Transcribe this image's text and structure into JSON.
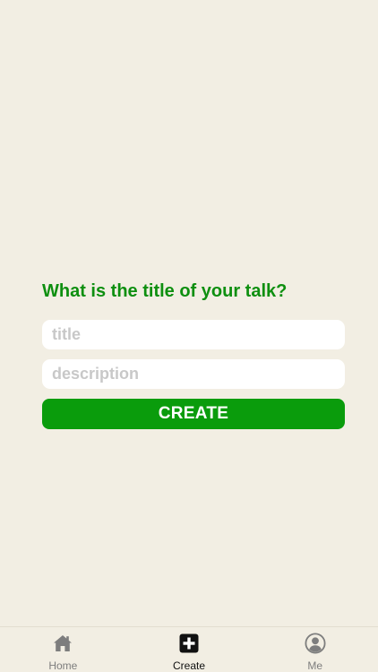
{
  "form": {
    "question": "What is the title of your talk?",
    "title_placeholder": "title",
    "title_value": "",
    "description_placeholder": "description",
    "description_value": "",
    "create_label": "CREATE"
  },
  "tabbar": {
    "tabs": [
      {
        "label": "Home",
        "icon": "home-icon",
        "active": false
      },
      {
        "label": "Create",
        "icon": "plus-square-icon",
        "active": true
      },
      {
        "label": "Me",
        "icon": "user-circle-icon",
        "active": false
      }
    ]
  },
  "colors": {
    "background": "#f2eee3",
    "accent_green": "#0a9c0c",
    "question_green": "#0e8f10",
    "placeholder_gray": "#c8c8c8",
    "inactive_tab": "#7d7d7d",
    "active_tab": "#111111"
  }
}
